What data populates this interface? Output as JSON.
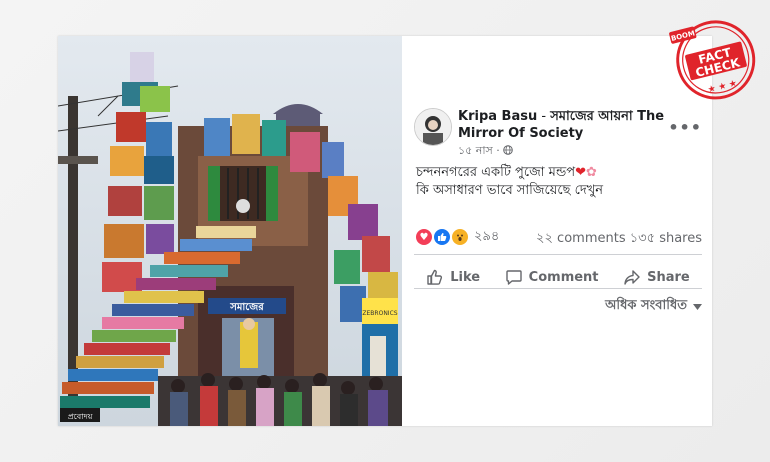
{
  "post": {
    "author": "Kripa Basu",
    "separator": " - ",
    "page_name": "সমাজের আয়না The Mirror Of Society",
    "time": "১৫ নাস",
    "privacy_icon": "globe-icon",
    "text_line1": "চন্দননগরের একটি পুজো মন্ডপ",
    "text_line2": "কি অসাধারণ ভাবে সাজিয়েছে দেখুন",
    "reaction_icons": [
      "love-icon",
      "like-icon",
      "wow-icon"
    ],
    "reaction_count": "২৯৪",
    "comments": "২২ comments",
    "shares": "১৩৫ shares",
    "more_icon": "more-options-icon"
  },
  "actions": {
    "like": "Like",
    "comment": "Comment",
    "share": "Share"
  },
  "related": {
    "label": "অধিক সংবাধিত",
    "icon": "caret-down-icon"
  },
  "photo": {
    "sign_left": "সমাজের",
    "sign_right": "ZEBRONICS",
    "step_label_bottom": "প্রবোদয়"
  },
  "stamp": {
    "badge": "BOOM",
    "line1": "FACT",
    "line2": "CHECK"
  },
  "colors": {
    "stamp_red": "#e0242b",
    "fb_blue": "#1877f2",
    "love": "#f33e58",
    "wow": "#f7b125"
  }
}
